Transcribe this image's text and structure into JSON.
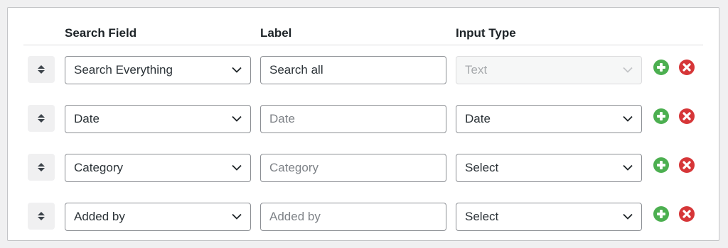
{
  "headers": {
    "search_field": "Search Field",
    "label": "Label",
    "input_type": "Input Type"
  },
  "colors": {
    "add": "#4caf50",
    "remove": "#d63638",
    "border": "#8c8f94"
  },
  "icons": {
    "drag": "sort-handle-icon",
    "add": "plus-circle-icon",
    "remove": "x-circle-icon",
    "dropdown": "chevron-down-icon"
  },
  "rows": [
    {
      "search_field": "Search Everything",
      "label_value": "Search all",
      "label_placeholder": "",
      "input_type": "Text",
      "input_type_disabled": true
    },
    {
      "search_field": "Date",
      "label_value": "",
      "label_placeholder": "Date",
      "input_type": "Date",
      "input_type_disabled": false
    },
    {
      "search_field": "Category",
      "label_value": "",
      "label_placeholder": "Category",
      "input_type": "Select",
      "input_type_disabled": false
    },
    {
      "search_field": "Added by",
      "label_value": "",
      "label_placeholder": "Added by",
      "input_type": "Select",
      "input_type_disabled": false
    }
  ]
}
